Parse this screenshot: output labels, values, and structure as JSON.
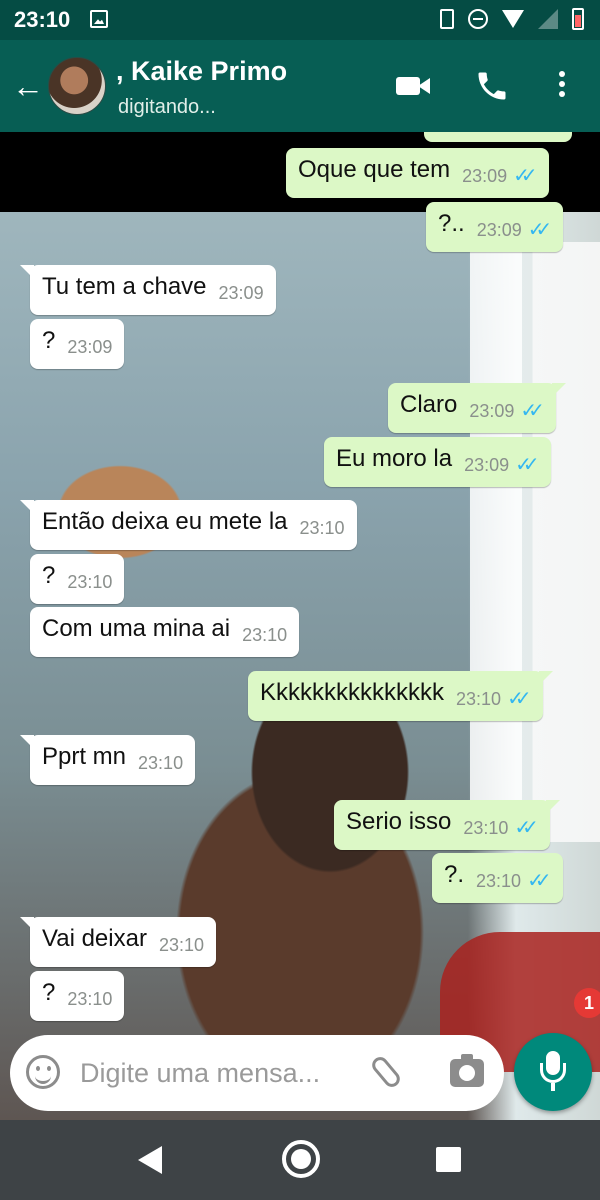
{
  "status_bar": {
    "time": "23:10"
  },
  "header": {
    "contact_name": ", Kaike Primo",
    "contact_status": "digitando..."
  },
  "messages": [
    {
      "text": "Oque que tem",
      "time": "23:09",
      "direction": "out",
      "ticks": "✓✓"
    },
    {
      "text": "?..",
      "time": "23:09",
      "direction": "out",
      "ticks": "✓✓"
    },
    {
      "text": "Tu tem a chave",
      "time": "23:09",
      "direction": "in"
    },
    {
      "text": "?",
      "time": "23:09",
      "direction": "in"
    },
    {
      "text": "Claro",
      "time": "23:09",
      "direction": "out",
      "ticks": "✓✓"
    },
    {
      "text": "Eu moro la",
      "time": "23:09",
      "direction": "out",
      "ticks": "✓✓"
    },
    {
      "text": "Então deixa eu mete la",
      "time": "23:10",
      "direction": "in"
    },
    {
      "text": "?",
      "time": "23:10",
      "direction": "in"
    },
    {
      "text": "Com uma mina ai",
      "time": "23:10",
      "direction": "in"
    },
    {
      "text": "Kkkkkkkkkkkkkkk",
      "time": "23:10",
      "direction": "out",
      "ticks": "✓✓"
    },
    {
      "text": "Pprt mn",
      "time": "23:10",
      "direction": "in"
    },
    {
      "text": "Serio isso",
      "time": "23:10",
      "direction": "out",
      "ticks": "✓✓"
    },
    {
      "text": "?.",
      "time": "23:10",
      "direction": "out",
      "ticks": "✓✓"
    },
    {
      "text": "Vai deixar",
      "time": "23:10",
      "direction": "in"
    },
    {
      "text": "?",
      "time": "23:10",
      "direction": "in"
    }
  ],
  "composer": {
    "placeholder": "Digite uma mensa...",
    "unread_badge": "1"
  },
  "colors": {
    "header": "#075e54",
    "status_bar": "#054c44",
    "outgoing_bubble": "#dcf8c6",
    "incoming_bubble": "#ffffff",
    "read_ticks": "#34b7f1",
    "mic_button": "#00897b",
    "badge": "#e53935"
  }
}
